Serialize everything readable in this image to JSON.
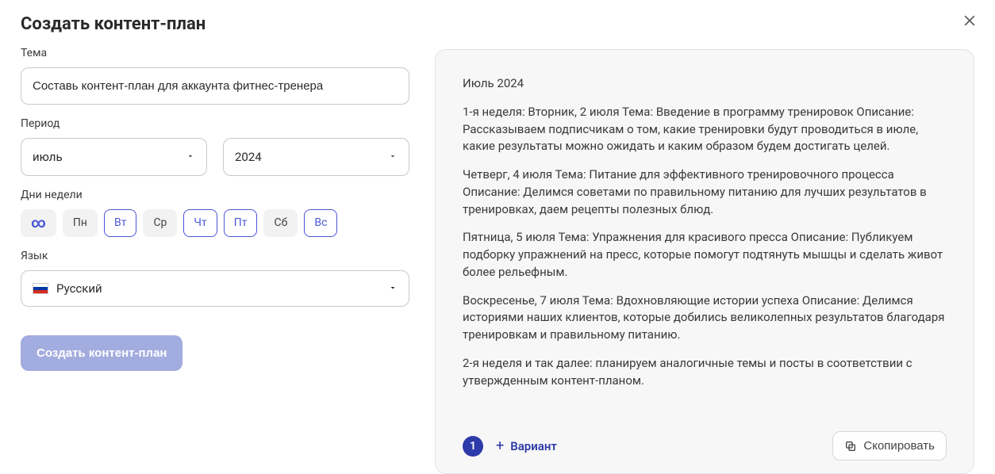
{
  "modal": {
    "title": "Создать контент-план"
  },
  "theme": {
    "label": "Тема",
    "value": "Составь контент-план для аккаунта фитнес-тренера"
  },
  "period": {
    "label": "Период",
    "month": "июль",
    "year": "2024"
  },
  "days": {
    "label": "Дни недели",
    "items": [
      {
        "label": "∞",
        "selected": false,
        "infinity": true
      },
      {
        "label": "Пн",
        "selected": false
      },
      {
        "label": "Вт",
        "selected": true
      },
      {
        "label": "Ср",
        "selected": false
      },
      {
        "label": "Чт",
        "selected": true
      },
      {
        "label": "Пт",
        "selected": true
      },
      {
        "label": "Сб",
        "selected": false
      },
      {
        "label": "Вс",
        "selected": true
      }
    ]
  },
  "language": {
    "label": "Язык",
    "value": "Русский"
  },
  "actions": {
    "create": "Создать контент-план",
    "variant": "Вариант",
    "copy": "Скопировать"
  },
  "result": {
    "badge": "1",
    "heading": "Июль 2024",
    "paragraphs": [
      "1-я неделя: Вторник, 2 июля Тема: Введение в программу тренировок Описание: Рассказываем подписчикам о том, какие тренировки будут проводиться в июле, какие результаты можно ожидать и каким образом будем достигать целей.",
      "Четверг, 4 июля Тема: Питание для эффективного тренировочного процесса Описание: Делимся советами по правильному питанию для лучших результатов в тренировках, даем рецепты полезных блюд.",
      "Пятница, 5 июля Тема: Упражнения для красивого пресса Описание: Публикуем подборку упражнений на пресс, которые помогут подтянуть мышцы и сделать живот более рельефным.",
      "Воскресенье, 7 июля Тема: Вдохновляющие истории успеха Описание: Делимся историями наших клиентов, которые добились великолепных результатов благодаря тренировкам и правильному питанию.",
      "2-я неделя и так далее: планируем аналогичные темы и посты в соответствии с утвержденным контент-планом."
    ]
  }
}
